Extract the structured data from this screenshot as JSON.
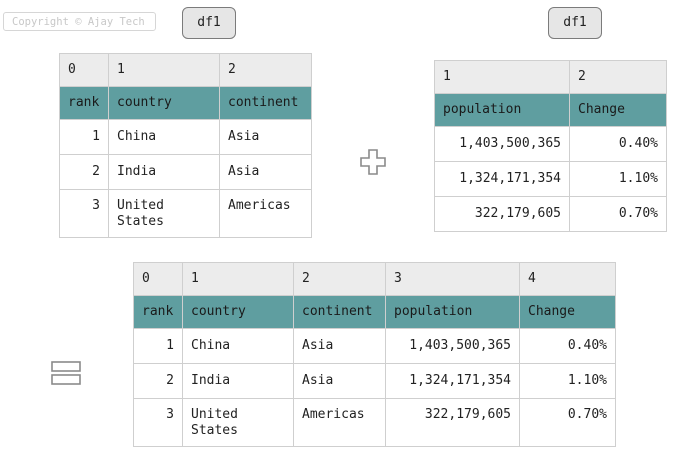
{
  "copyright": "Copyright © Ajay Tech",
  "df_labels": {
    "left": "df1",
    "right": "df1"
  },
  "left_table": {
    "index": [
      "0",
      "1",
      "2"
    ],
    "header": [
      "rank",
      "country",
      "continent"
    ],
    "rows": [
      [
        "1",
        "China",
        "Asia"
      ],
      [
        "2",
        "India",
        "Asia"
      ],
      [
        "3",
        "United States",
        "Americas"
      ]
    ]
  },
  "right_table": {
    "index": [
      "1",
      "2"
    ],
    "header": [
      "population",
      "Change"
    ],
    "rows": [
      [
        "1,403,500,365",
        "0.40%"
      ],
      [
        "1,324,171,354",
        "1.10%"
      ],
      [
        "322,179,605",
        "0.70%"
      ]
    ]
  },
  "result_table": {
    "index": [
      "0",
      "1",
      "2",
      "3",
      "4"
    ],
    "header": [
      "rank",
      "country",
      "continent",
      "population",
      "Change"
    ],
    "rows": [
      [
        "1",
        "China",
        "Asia",
        "1,403,500,365",
        "0.40%"
      ],
      [
        "2",
        "India",
        "Asia",
        "1,324,171,354",
        "1.10%"
      ],
      [
        "3",
        "United States",
        "Americas",
        "322,179,605",
        "0.70%"
      ]
    ]
  },
  "icons": {
    "plus": "plus-icon",
    "equals": "equals-icon"
  }
}
